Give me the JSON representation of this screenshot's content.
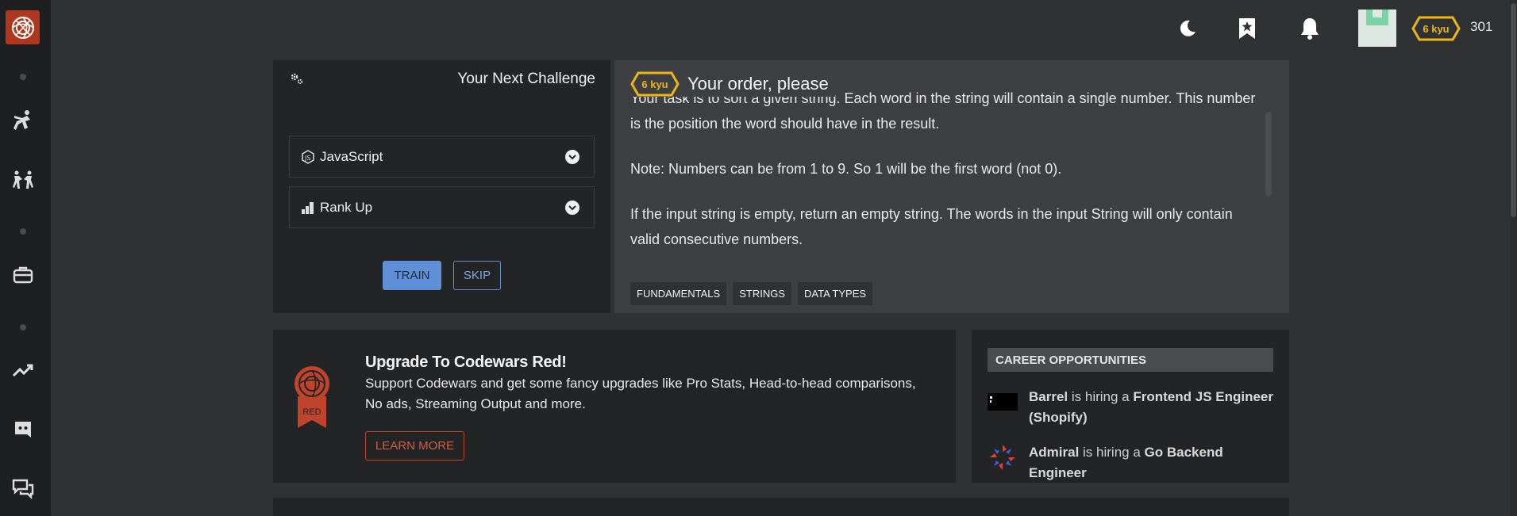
{
  "colors": {
    "brand_red": "#b1361e",
    "kyu_yellow": "#ecb613",
    "train_blue": "#5f8fd7"
  },
  "sidebar": {
    "logo_icon": "codewars-logo",
    "items": [
      {
        "icon": "training-kick-icon"
      },
      {
        "icon": "practice-fight-icon"
      },
      {
        "icon": "briefcase-icon"
      },
      {
        "icon": "trending-up-icon"
      },
      {
        "icon": "discord-icon"
      },
      {
        "icon": "chat-bubbles-icon"
      }
    ]
  },
  "topbar": {
    "icons": [
      "moon-icon",
      "bookmark-star-icon",
      "bell-icon"
    ],
    "rank": "6 kyu",
    "honor": "301"
  },
  "challenge": {
    "heading": "Your Next Challenge",
    "language": "JavaScript",
    "strategy": "Rank Up",
    "train_label": "TRAIN",
    "skip_label": "SKIP",
    "kata_rank": "6 kyu",
    "kata_title": "Your order, please",
    "description": [
      "Your task is to sort a given string. Each word in the string will contain a single number. This number is the position the word should have in the result.",
      "Note: Numbers can be from 1 to 9. So 1 will be the first word (not 0).",
      "If the input string is empty, return an empty string. The words in the input String will only contain valid consecutive numbers."
    ],
    "tags": [
      "FUNDAMENTALS",
      "STRINGS",
      "DATA TYPES"
    ]
  },
  "upgrade": {
    "badge_text": "RED",
    "title": "Upgrade To Codewars Red!",
    "text": "Support Codewars and get some fancy upgrades like Pro Stats, Head-to-head comparisons, No ads, Streaming Output and more.",
    "button": "LEARN MORE"
  },
  "career": {
    "heading": "CAREER OPPORTUNITIES",
    "hiring_text": "is hiring a",
    "jobs": [
      {
        "company": "Barrel",
        "role": "Frontend JS Engineer (Shopify)"
      },
      {
        "company": "Admiral",
        "role": "Go Backend Engineer"
      }
    ]
  }
}
